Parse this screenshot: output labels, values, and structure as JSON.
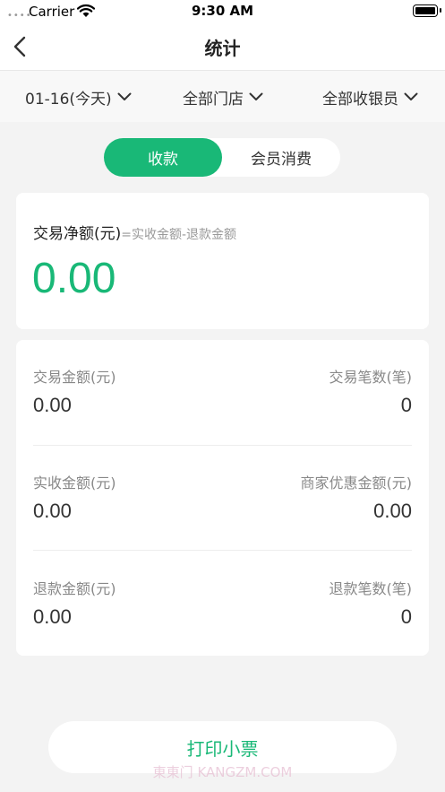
{
  "status_bar": {
    "signal": "••••",
    "carrier": "Carrier",
    "time": "9:30 AM"
  },
  "nav": {
    "title": "统计"
  },
  "filters": {
    "date": "01-16(今天)",
    "store": "全部门店",
    "cashier": "全部收银员"
  },
  "tabs": [
    {
      "label": "收款",
      "active": true
    },
    {
      "label": "会员消费",
      "active": false
    }
  ],
  "net": {
    "label": "交易净额(元)",
    "formula": "=实收金额-退款金额",
    "value": "0.00"
  },
  "stats": {
    "trade_amount": {
      "label": "交易金额(元)",
      "value": "0.00"
    },
    "trade_count": {
      "label": "交易笔数(笔)",
      "value": "0"
    },
    "received_amount": {
      "label": "实收金额(元)",
      "value": "0.00"
    },
    "merchant_discount": {
      "label": "商家优惠金额(元)",
      "value": "0.00"
    },
    "refund_amount": {
      "label": "退款金额(元)",
      "value": "0.00"
    },
    "refund_count": {
      "label": "退款笔数(笔)",
      "value": "0"
    }
  },
  "print_button": {
    "label": "打印小票"
  },
  "watermark": "東東门 KANGZM.COM",
  "colors": {
    "accent": "#19b877",
    "background": "#f3f3f3"
  }
}
